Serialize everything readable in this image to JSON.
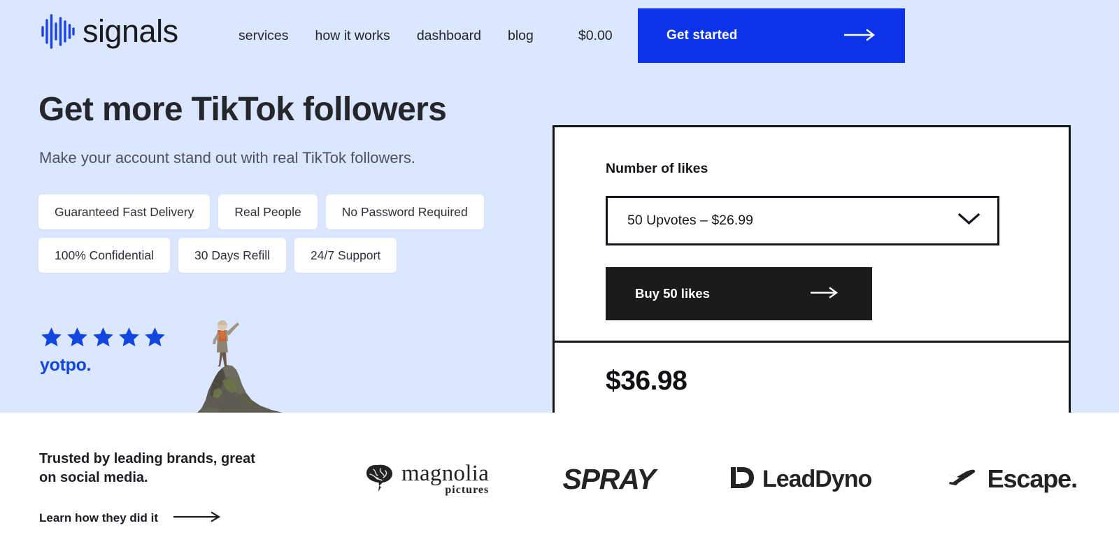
{
  "brand": {
    "name": "signals",
    "logo_icon": "audio-waveform-icon",
    "accent_color": "#0b34e8"
  },
  "header": {
    "nav": [
      {
        "label": "services",
        "name": "services"
      },
      {
        "label": "how it works",
        "name": "how-it-works"
      },
      {
        "label": "dashboard",
        "name": "dashboard"
      },
      {
        "label": "blog",
        "name": "blog"
      }
    ],
    "cart_total": "$0.00",
    "cta": {
      "label": "Get started",
      "icon": "arrow-right-icon"
    }
  },
  "hero": {
    "title": "Get more TikTok followers",
    "subtitle": "Make your account stand out with real TikTok followers.",
    "chips": [
      "Guaranteed Fast Delivery",
      "Real People",
      "No Password Required",
      "100% Confidential",
      "30 Days Refill",
      "24/7 Support"
    ],
    "rating": {
      "stars": 5,
      "star_icon": "star-icon",
      "provider": "yotpo.",
      "star_color": "#1246e0"
    },
    "illustration": "hiker-on-summit-image"
  },
  "purchase_card": {
    "field_label": "Number of likes",
    "select": {
      "selected": "50 Upvotes – $26.99",
      "icon": "chevron-down-icon"
    },
    "buy_button": {
      "label": "Buy 50 likes",
      "icon": "arrow-right-icon"
    },
    "total_price": "$36.98"
  },
  "trust_band": {
    "headline_line1": "Trusted by leading brands, great",
    "headline_line2": "on social media.",
    "link": {
      "label": "Learn how they did it",
      "icon": "arrow-right-icon"
    },
    "brands": [
      {
        "name": "magnolia-pictures",
        "main": "magnolia",
        "sub": "pictures",
        "icon": "brain-icon"
      },
      {
        "name": "spray",
        "main": "SPRAY"
      },
      {
        "name": "leaddyno",
        "main": "LeadDyno",
        "icon": "ld-monogram-icon"
      },
      {
        "name": "escape",
        "main": "Escape.",
        "icon": "airplane-icon"
      }
    ]
  }
}
